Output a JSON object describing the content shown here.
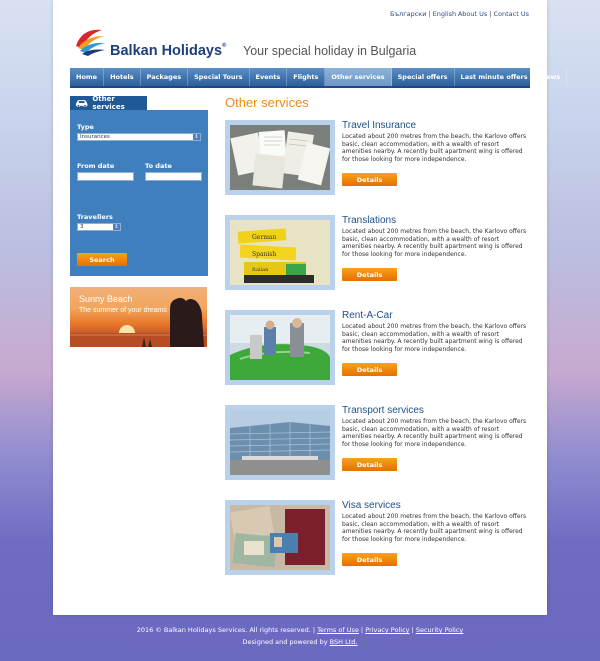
{
  "header": {
    "lang_bg": "Български",
    "lang_en": "English",
    "about": "About Us",
    "contact": "Contact Us",
    "brand": "Balkan Holidays",
    "brand_mark": "®",
    "tagline": "Your special holiday in Bulgaria"
  },
  "nav": [
    {
      "label": "Home"
    },
    {
      "label": "Hotels"
    },
    {
      "label": "Packages"
    },
    {
      "label": "Special Tours"
    },
    {
      "label": "Events"
    },
    {
      "label": "Flights"
    },
    {
      "label": "Other services"
    },
    {
      "label": "Special offers"
    },
    {
      "label": "Last minute offers"
    },
    {
      "label": "News"
    }
  ],
  "nav_active": "Other services",
  "sidebar": {
    "tab_label": "Other services",
    "tab_icon": "car-icon",
    "type_label": "Type",
    "type_value": "Insurances",
    "from_label": "From date",
    "to_label": "To date",
    "travellers_label": "Travellers",
    "travellers_value": "3",
    "search_button": "Search"
  },
  "promo": {
    "title": "Sunny Beach",
    "subtitle": "The summer of your dreams"
  },
  "main": {
    "title": "Other services",
    "services": [
      {
        "title": "Travel Insurance",
        "description": "Located about 200 metres from the beach, the Karlovo offers basic, clean accommodation, with a wealth of resort amenities nearby. A recently built apartment wing is offered for those looking for more independence.",
        "button": "Details",
        "image": "documents-photo"
      },
      {
        "title": "Translations",
        "description": "Located about 200 metres from the beach, the Karlovo offers basic, clean accommodation, with a wealth of resort amenities nearby. A recently built apartment wing is offered for those looking for more independence.",
        "button": "Details",
        "image": "dictionaries-photo"
      },
      {
        "title": "Rent-A-Car",
        "description": "Located about 200 metres from the beach, the Karlovo offers basic, clean accommodation, with a wealth of resort amenities nearby. A recently built apartment wing is offered for those looking for more independence.",
        "button": "Details",
        "image": "car-rental-photo"
      },
      {
        "title": "Transport services",
        "description": "Located about 200 metres from the beach, the Karlovo offers basic, clean accommodation, with a wealth of resort amenities nearby. A recently built apartment wing is offered for those looking for more independence.",
        "button": "Details",
        "image": "airport-photo"
      },
      {
        "title": "Visa services",
        "description": "Located about 200 metres from the beach, the Karlovo offers basic, clean accommodation, with a wealth of resort amenities nearby. A recently built apartment wing is offered for those looking for more independence.",
        "button": "Details",
        "image": "passports-photo"
      }
    ]
  },
  "footer": {
    "copyright": "2016 © Balkan Holidays Services. All rights reserved.",
    "terms": "Terms of Use",
    "privacy": "Privacy Policy",
    "security": "Security Policy",
    "powered_prefix": "Designed and powered by",
    "powered_by": "BSH Ltd."
  },
  "colors": {
    "accent_orange": "#f08a17",
    "nav_blue": "#2c5f9b",
    "sidebar_blue": "#3f7fbd",
    "title_blue": "#1f4f8a"
  }
}
